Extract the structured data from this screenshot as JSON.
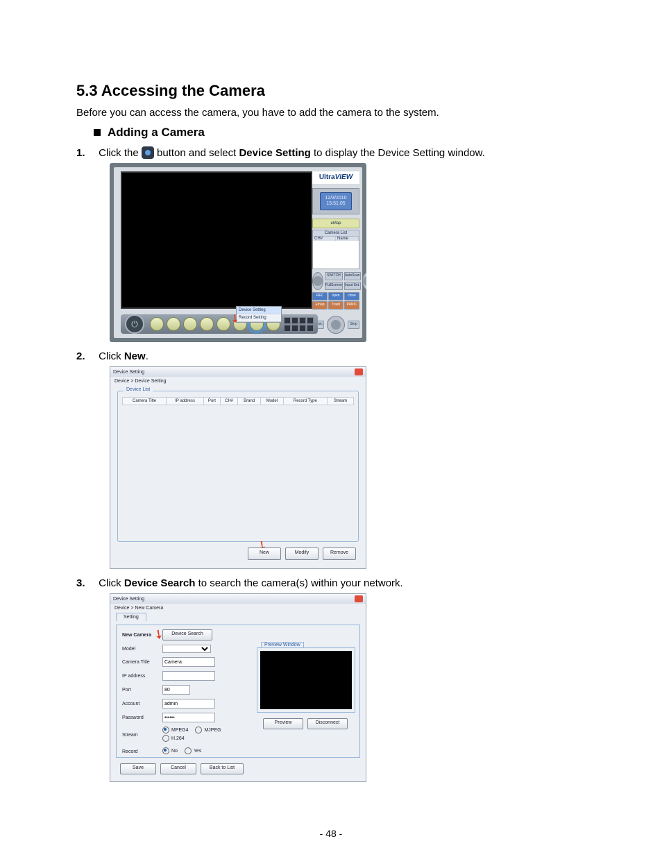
{
  "heading": "5.3  Accessing the Camera",
  "intro": "Before you can access the camera, you have to add the camera to the system.",
  "subheading": "Adding a Camera",
  "steps": {
    "s1_num": "1.",
    "s1_a": "Click the ",
    "s1_b": " button and select ",
    "s1_bold": "Device Setting",
    "s1_c": " to display the Device Setting window.",
    "s2_num": "2.",
    "s2_a": "Click ",
    "s2_bold": "New",
    "s2_b": ".",
    "s3_num": "3.",
    "s3_a": "Click ",
    "s3_bold": "Device Search",
    "s3_b": " to search the camera(s) within your network."
  },
  "ss1": {
    "brand_a": "Ultra",
    "brand_b": "VIEW",
    "date": "12/3/2010",
    "time": "15:51:05",
    "emap": "eMap",
    "camlist_hdr": "Camera List",
    "col_ch": "CH#",
    "col_name": "Name",
    "btn_switch": "SWITCH",
    "btn_autoscan": "AutoScan",
    "btn_fullscreen": "FullScreen",
    "btn_inputset": "Input Set.",
    "mini1": "REC",
    "mini2": "open",
    "mini3": "close",
    "mini4": "Emap",
    "mini5": "Trash",
    "mini6": "PANIC",
    "wide1": "Panic",
    "wide2": "Stop",
    "menu_device": "Device Setting",
    "menu_record": "Record Setting"
  },
  "ss2": {
    "title": "Device Setting",
    "crumb": "Device > Device Setting",
    "legend": "Device List",
    "th": [
      "Camera Title",
      "IP address",
      "Port",
      "CH#",
      "Brand",
      "Model",
      "Record Type",
      "Stream"
    ],
    "btn_new": "New",
    "btn_modify": "Modify",
    "btn_remove": "Remove"
  },
  "ss3": {
    "title": "Device Setting",
    "crumb": "Device > New Camera",
    "tab": "Setting",
    "row_new": "New Camera",
    "btn_search": "Device Search",
    "lab_model": "Model",
    "lab_title": "Camera Title",
    "val_title": "Camera",
    "lab_ip": "IP address",
    "lab_port": "Port",
    "val_port": "80",
    "lab_account": "Account",
    "val_account": "admin",
    "lab_password": "Password",
    "val_password": "••••••",
    "lab_stream": "Stream",
    "opt_mpeg4": "MPEG4",
    "opt_mjpeg": "MJPEG",
    "opt_h264": "H.264",
    "lab_record": "Record",
    "opt_no": "No",
    "opt_yes": "Yes",
    "pv_label": "Preview Window",
    "btn_preview": "Preview",
    "btn_disconnect": "Disconnect",
    "btn_save": "Save",
    "btn_cancel": "Cancel",
    "btn_back": "Back to List"
  },
  "page_number": "- 48 -"
}
